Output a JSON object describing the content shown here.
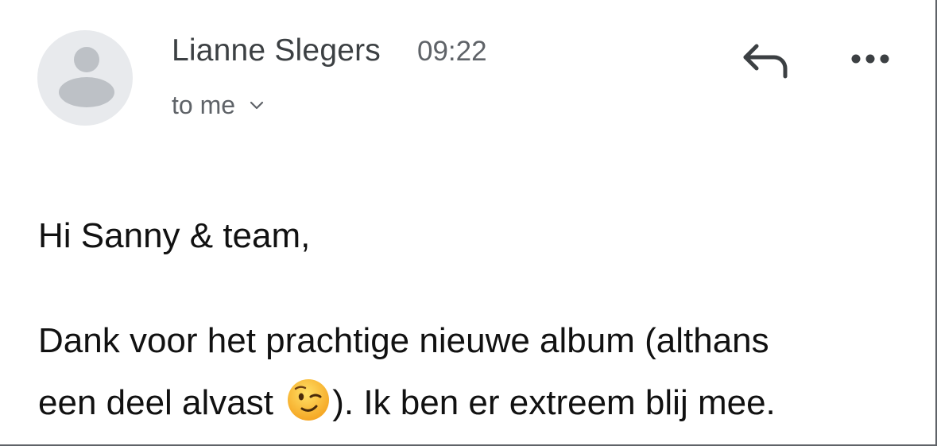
{
  "email": {
    "sender_name": "Lianne Slegers",
    "time": "09:22",
    "recipient_label": "to me",
    "greeting": "Hi Sanny & team,",
    "body_line1": "Dank voor het prachtige nieuwe album (althans",
    "body_line2_before_emoji": "een deel alvast ",
    "body_line2_after_emoji": "). Ik ben er extreem blij mee.",
    "emoji": "winking-face"
  },
  "icons": {
    "avatar": "default-person-avatar",
    "reply": "reply-arrow-icon",
    "more": "more-horizontal-icon",
    "recipient_toggle": "chevron-down-icon"
  },
  "colors": {
    "text_primary": "#111111",
    "text_secondary": "#5f6368",
    "avatar_bg": "#e8eaed",
    "avatar_fg": "#bdc1c6"
  }
}
